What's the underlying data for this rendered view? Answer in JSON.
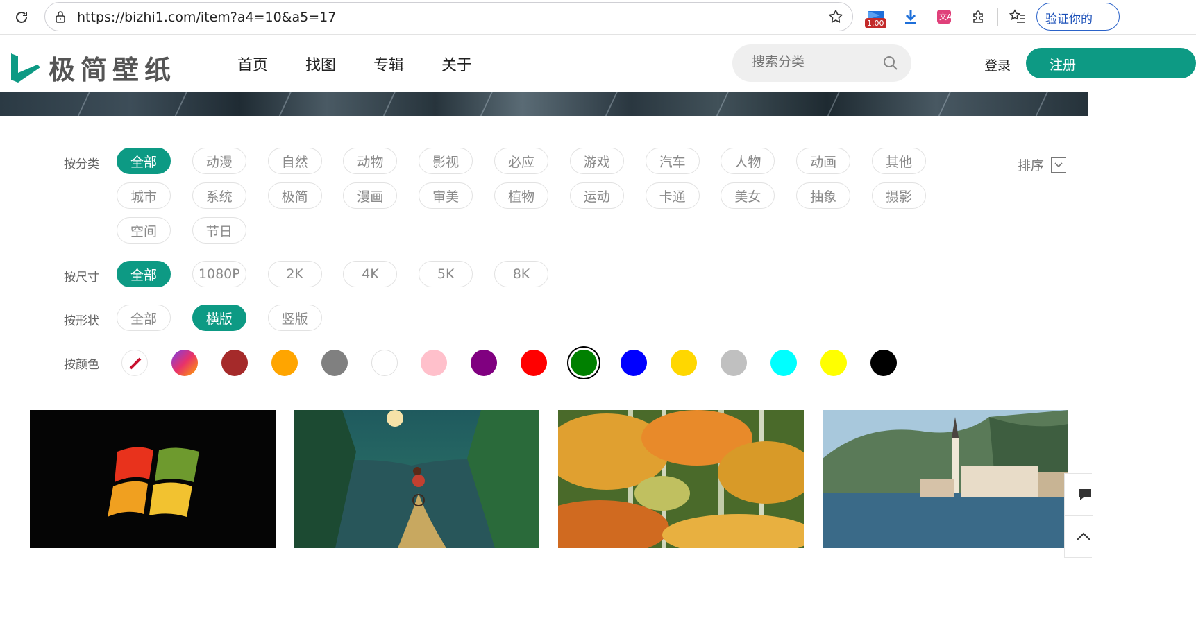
{
  "browser": {
    "url": "https://bizhi1.com/item?a4=10&a5=17",
    "ext_badge": "1.00",
    "verify_label": "验证你的"
  },
  "header": {
    "logo_text": "极简壁纸",
    "nav": [
      "首页",
      "找图",
      "专辑",
      "关于"
    ],
    "search_placeholder": "搜索分类",
    "login": "登录",
    "register": "注册"
  },
  "filters": {
    "category": {
      "label": "按分类",
      "items": [
        "全部",
        "动漫",
        "自然",
        "动物",
        "影视",
        "必应",
        "游戏",
        "汽车",
        "人物",
        "动画",
        "其他",
        "城市",
        "系统",
        "极简",
        "漫画",
        "审美",
        "植物",
        "运动",
        "卡通",
        "美女",
        "抽象",
        "摄影",
        "空间",
        "节日"
      ],
      "active_index": 0
    },
    "size": {
      "label": "按尺寸",
      "items": [
        "全部",
        "1080P",
        "2K",
        "4K",
        "5K",
        "8K"
      ],
      "active_index": 0
    },
    "shape": {
      "label": "按形状",
      "items": [
        "全部",
        "横版",
        "竖版"
      ],
      "active_index": 1
    },
    "color": {
      "label": "按颜色",
      "swatches": [
        "none",
        "gradient",
        "#a52a2a",
        "#ffa500",
        "#808080",
        "#ffffff",
        "#ffc0cb",
        "#800080",
        "#ff0000",
        "#008000",
        "#0000ff",
        "#ffd700",
        "#c0c0c0",
        "#00ffff",
        "#ffff00",
        "#000000"
      ],
      "selected_index": 9
    },
    "sort_label": "排序"
  },
  "accent": "#0d9a84"
}
